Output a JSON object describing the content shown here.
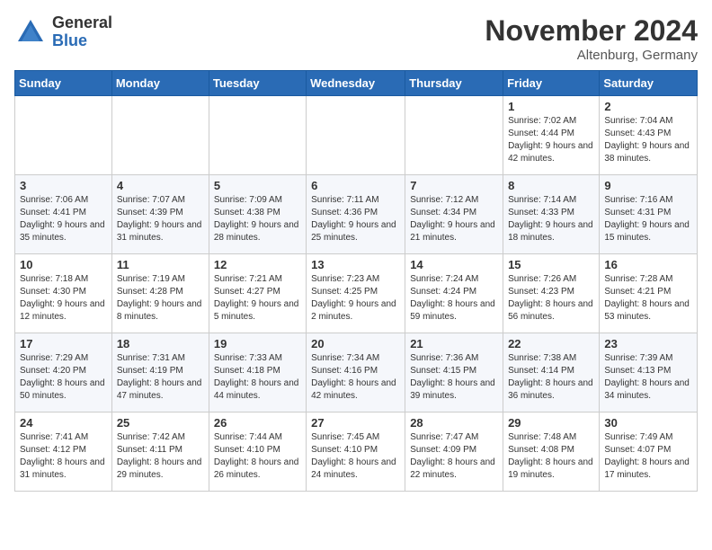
{
  "header": {
    "logo_general": "General",
    "logo_blue": "Blue",
    "month_title": "November 2024",
    "location": "Altenburg, Germany"
  },
  "weekdays": [
    "Sunday",
    "Monday",
    "Tuesday",
    "Wednesday",
    "Thursday",
    "Friday",
    "Saturday"
  ],
  "weeks": [
    [
      {
        "day": "",
        "info": ""
      },
      {
        "day": "",
        "info": ""
      },
      {
        "day": "",
        "info": ""
      },
      {
        "day": "",
        "info": ""
      },
      {
        "day": "",
        "info": ""
      },
      {
        "day": "1",
        "info": "Sunrise: 7:02 AM\nSunset: 4:44 PM\nDaylight: 9 hours and 42 minutes."
      },
      {
        "day": "2",
        "info": "Sunrise: 7:04 AM\nSunset: 4:43 PM\nDaylight: 9 hours and 38 minutes."
      }
    ],
    [
      {
        "day": "3",
        "info": "Sunrise: 7:06 AM\nSunset: 4:41 PM\nDaylight: 9 hours and 35 minutes."
      },
      {
        "day": "4",
        "info": "Sunrise: 7:07 AM\nSunset: 4:39 PM\nDaylight: 9 hours and 31 minutes."
      },
      {
        "day": "5",
        "info": "Sunrise: 7:09 AM\nSunset: 4:38 PM\nDaylight: 9 hours and 28 minutes."
      },
      {
        "day": "6",
        "info": "Sunrise: 7:11 AM\nSunset: 4:36 PM\nDaylight: 9 hours and 25 minutes."
      },
      {
        "day": "7",
        "info": "Sunrise: 7:12 AM\nSunset: 4:34 PM\nDaylight: 9 hours and 21 minutes."
      },
      {
        "day": "8",
        "info": "Sunrise: 7:14 AM\nSunset: 4:33 PM\nDaylight: 9 hours and 18 minutes."
      },
      {
        "day": "9",
        "info": "Sunrise: 7:16 AM\nSunset: 4:31 PM\nDaylight: 9 hours and 15 minutes."
      }
    ],
    [
      {
        "day": "10",
        "info": "Sunrise: 7:18 AM\nSunset: 4:30 PM\nDaylight: 9 hours and 12 minutes."
      },
      {
        "day": "11",
        "info": "Sunrise: 7:19 AM\nSunset: 4:28 PM\nDaylight: 9 hours and 8 minutes."
      },
      {
        "day": "12",
        "info": "Sunrise: 7:21 AM\nSunset: 4:27 PM\nDaylight: 9 hours and 5 minutes."
      },
      {
        "day": "13",
        "info": "Sunrise: 7:23 AM\nSunset: 4:25 PM\nDaylight: 9 hours and 2 minutes."
      },
      {
        "day": "14",
        "info": "Sunrise: 7:24 AM\nSunset: 4:24 PM\nDaylight: 8 hours and 59 minutes."
      },
      {
        "day": "15",
        "info": "Sunrise: 7:26 AM\nSunset: 4:23 PM\nDaylight: 8 hours and 56 minutes."
      },
      {
        "day": "16",
        "info": "Sunrise: 7:28 AM\nSunset: 4:21 PM\nDaylight: 8 hours and 53 minutes."
      }
    ],
    [
      {
        "day": "17",
        "info": "Sunrise: 7:29 AM\nSunset: 4:20 PM\nDaylight: 8 hours and 50 minutes."
      },
      {
        "day": "18",
        "info": "Sunrise: 7:31 AM\nSunset: 4:19 PM\nDaylight: 8 hours and 47 minutes."
      },
      {
        "day": "19",
        "info": "Sunrise: 7:33 AM\nSunset: 4:18 PM\nDaylight: 8 hours and 44 minutes."
      },
      {
        "day": "20",
        "info": "Sunrise: 7:34 AM\nSunset: 4:16 PM\nDaylight: 8 hours and 42 minutes."
      },
      {
        "day": "21",
        "info": "Sunrise: 7:36 AM\nSunset: 4:15 PM\nDaylight: 8 hours and 39 minutes."
      },
      {
        "day": "22",
        "info": "Sunrise: 7:38 AM\nSunset: 4:14 PM\nDaylight: 8 hours and 36 minutes."
      },
      {
        "day": "23",
        "info": "Sunrise: 7:39 AM\nSunset: 4:13 PM\nDaylight: 8 hours and 34 minutes."
      }
    ],
    [
      {
        "day": "24",
        "info": "Sunrise: 7:41 AM\nSunset: 4:12 PM\nDaylight: 8 hours and 31 minutes."
      },
      {
        "day": "25",
        "info": "Sunrise: 7:42 AM\nSunset: 4:11 PM\nDaylight: 8 hours and 29 minutes."
      },
      {
        "day": "26",
        "info": "Sunrise: 7:44 AM\nSunset: 4:10 PM\nDaylight: 8 hours and 26 minutes."
      },
      {
        "day": "27",
        "info": "Sunrise: 7:45 AM\nSunset: 4:10 PM\nDaylight: 8 hours and 24 minutes."
      },
      {
        "day": "28",
        "info": "Sunrise: 7:47 AM\nSunset: 4:09 PM\nDaylight: 8 hours and 22 minutes."
      },
      {
        "day": "29",
        "info": "Sunrise: 7:48 AM\nSunset: 4:08 PM\nDaylight: 8 hours and 19 minutes."
      },
      {
        "day": "30",
        "info": "Sunrise: 7:49 AM\nSunset: 4:07 PM\nDaylight: 8 hours and 17 minutes."
      }
    ]
  ]
}
